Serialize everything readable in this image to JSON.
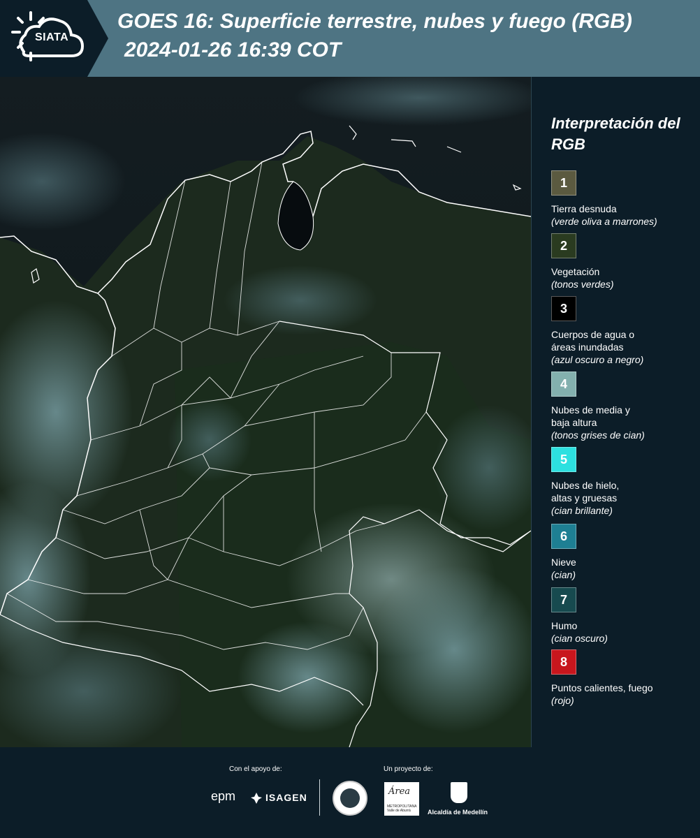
{
  "header": {
    "logo": "SIATA",
    "title": "GOES 16: Superficie terrestre, nubes y fuego (RGB)",
    "subtitle": "2024-01-26 16:39 COT"
  },
  "legend": {
    "title": "Interpretación del RGB",
    "items": [
      {
        "number": "1",
        "label": "Tierra desnuda",
        "desc": "(verde oliva a marrones)",
        "color": "#5b5a40"
      },
      {
        "number": "2",
        "label": "Vegetación",
        "desc": "(tonos verdes)",
        "color": "#2a3b20"
      },
      {
        "number": "3",
        "label": "Cuerpos de agua o\náreas inundadas",
        "desc": "(azul oscuro a negro)",
        "color": "#000000"
      },
      {
        "number": "4",
        "label": "Nubes de media y\nbaja altura",
        "desc": "(tonos grises de cian)",
        "color": "#83b0ae"
      },
      {
        "number": "5",
        "label": "Nubes de hielo,\naltas y gruesas",
        "desc": "(cian brillante)",
        "color": "#2de0e0"
      },
      {
        "number": "6",
        "label": "Nieve",
        "desc": "(cian)",
        "color": "#1e7f93"
      },
      {
        "number": "7",
        "label": "Humo",
        "desc": "(cian oscuro)",
        "color": "#174a4f"
      },
      {
        "number": "8",
        "label": "Puntos calientes, fuego",
        "desc": "(rojo)",
        "color": "#c8161d"
      }
    ]
  },
  "footer": {
    "support_label": "Con el apoyo de:",
    "project_label": "Un proyecto de:",
    "epm": "epm",
    "isagen": "ISAGEN",
    "amva": "Área",
    "amva_sub": "METROPOLITANA Valle de Aburrá",
    "medellin": "Alcaldía de Medellín"
  }
}
